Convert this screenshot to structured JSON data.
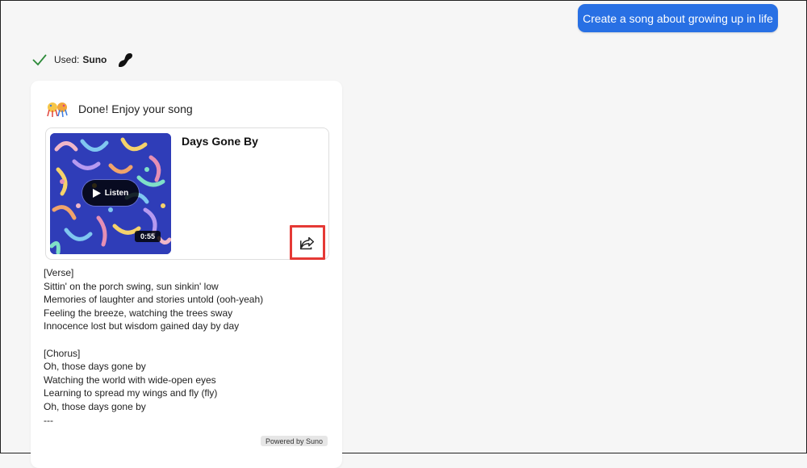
{
  "user_message": "Create a song about growing up in life",
  "used": {
    "label": "Used:",
    "value": "Suno",
    "check_icon": "check-icon",
    "logo_icon": "suno-logo-icon"
  },
  "card": {
    "status_text": "Done! Enjoy your song",
    "status_icon": "party-popper-icon",
    "song": {
      "title": "Days Gone By",
      "listen_label": "Listen",
      "duration": "0:55",
      "share_icon": "share-icon"
    },
    "lyrics": [
      "[Verse]",
      "Sittin' on the porch swing, sun sinkin' low",
      "Memories of laughter and stories untold (ooh-yeah)",
      "Feeling the breeze, watching the trees sway",
      "Innocence lost but wisdom gained day by day",
      "",
      "[Chorus]",
      "Oh, those days gone by",
      "Watching the world with wide-open eyes",
      "Learning to spread my wings and fly (fly)",
      "Oh, those days gone by",
      "---"
    ],
    "powered_by": "Powered by Suno"
  },
  "colors": {
    "accent": "#2870e4",
    "highlight": "#e53935",
    "check": "#2e8b3a"
  }
}
